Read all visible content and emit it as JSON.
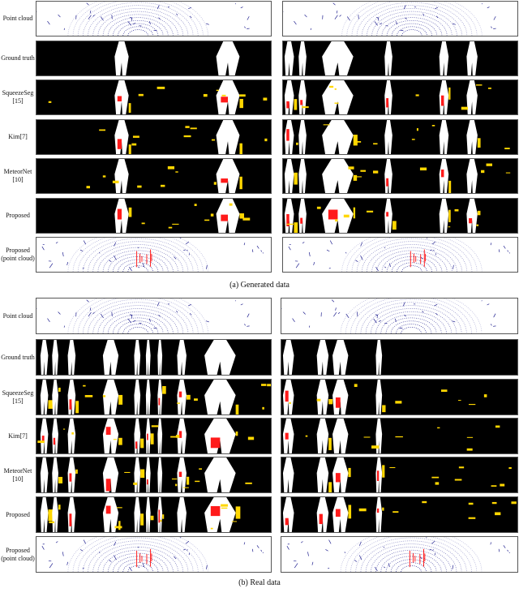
{
  "row_labels": [
    "Point cloud",
    "Ground truth",
    "SqueezeSeg [15]",
    "Kim[7]",
    "MeteorNet [10]",
    "Proposed",
    "Proposed (point cloud)"
  ],
  "row_types": [
    "cloud",
    "seg",
    "seg",
    "seg",
    "seg",
    "seg",
    "cloud"
  ],
  "captions": {
    "a": "(a) Generated data",
    "b": "(b) Real data"
  },
  "colors": {
    "background": "#000000",
    "ground_truth": "#ffffff",
    "false_negative": "#ff1a1a",
    "false_positive": "#ffd700",
    "point_cloud": "#1a1a8c"
  }
}
